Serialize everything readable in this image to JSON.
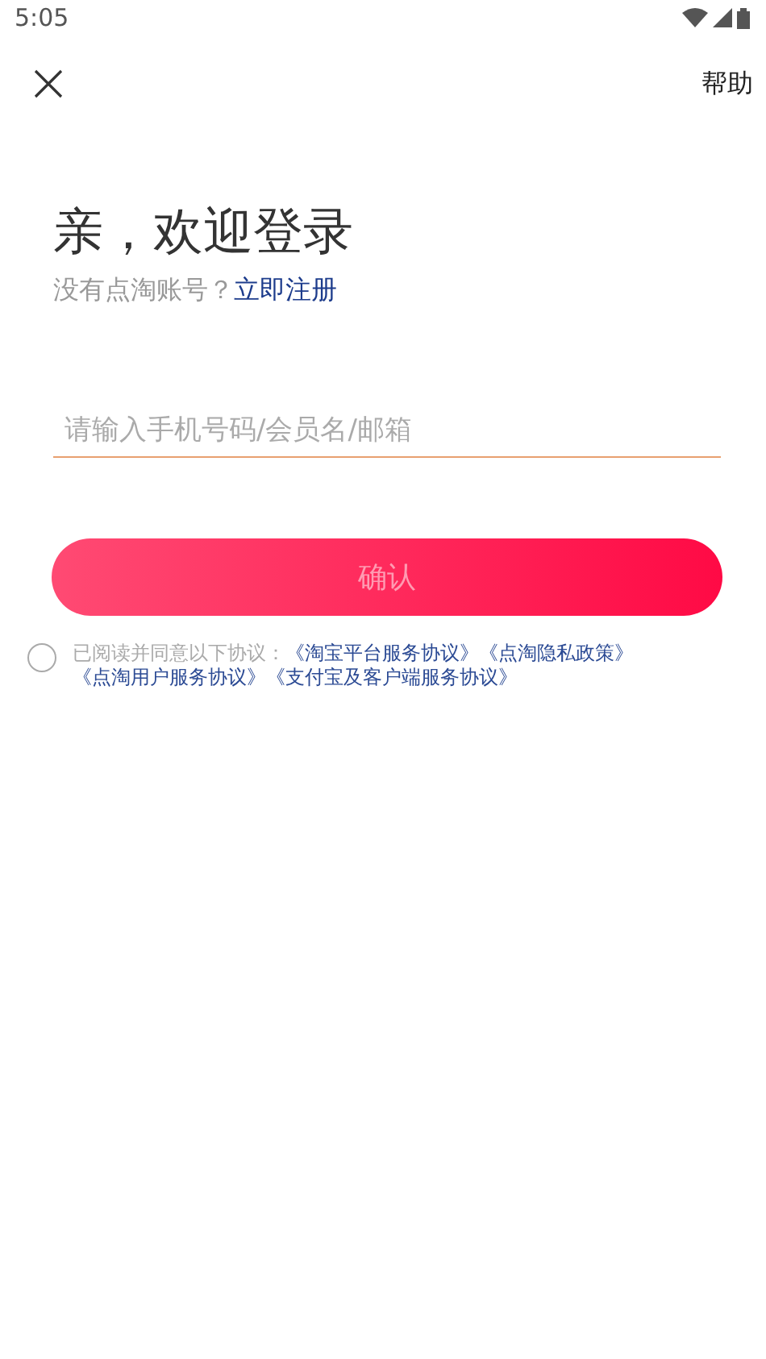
{
  "status_bar": {
    "time": "5:05"
  },
  "header": {
    "help": "帮助"
  },
  "title": "亲，欢迎登录",
  "register": {
    "prompt": "没有点淘账号？",
    "link": "立即注册"
  },
  "account_field": {
    "placeholder": "请输入手机号码/会员名/邮箱"
  },
  "confirm_button": {
    "label": "确认",
    "disabled": true
  },
  "agreement": {
    "checked": false,
    "lead": "已阅读并同意以下协议：",
    "links": [
      "《淘宝平台服务协议》",
      "《点淘隐私政策》",
      "《点淘用户服务协议》",
      "《支付宝及客户端服务协议》"
    ]
  }
}
